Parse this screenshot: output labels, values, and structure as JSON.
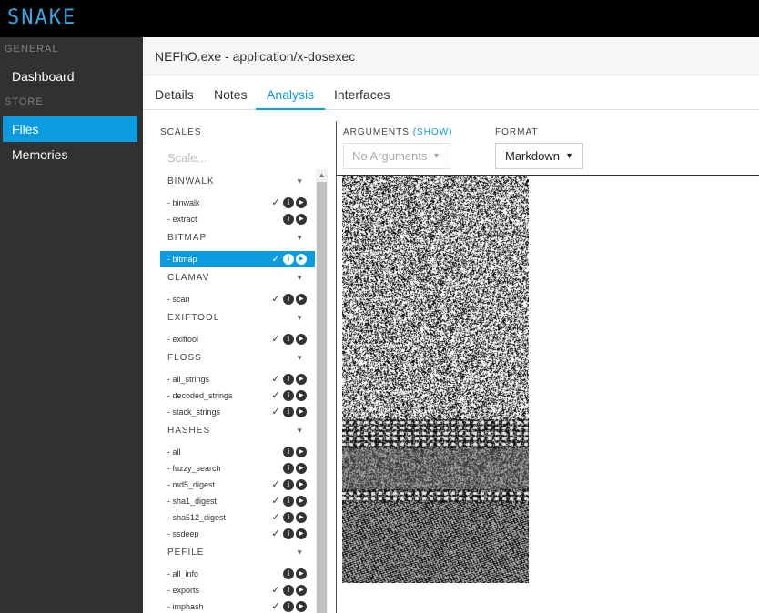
{
  "app": {
    "logo": "SNAKE"
  },
  "sidebar": {
    "general_label": "GENERAL",
    "dashboard": "Dashboard",
    "store_label": "STORE",
    "files": "Files",
    "memories": "Memories"
  },
  "header": {
    "title": "NEFhO.exe - application/x-dosexec"
  },
  "tabs": [
    {
      "label": "Details"
    },
    {
      "label": "Notes"
    },
    {
      "label": "Analysis"
    },
    {
      "label": "Interfaces"
    }
  ],
  "scales": {
    "title": "SCALES",
    "search_placeholder": "Scale...",
    "groups": [
      {
        "name": "BINWALK",
        "items": [
          {
            "label": "- binwalk",
            "done": true,
            "active": false
          },
          {
            "label": "- extract",
            "done": false,
            "active": false
          }
        ]
      },
      {
        "name": "BITMAP",
        "items": [
          {
            "label": "- bitmap",
            "done": true,
            "active": true
          }
        ]
      },
      {
        "name": "CLAMAV",
        "items": [
          {
            "label": "- scan",
            "done": true,
            "active": false
          }
        ]
      },
      {
        "name": "EXIFTOOL",
        "items": [
          {
            "label": "- exiftool",
            "done": true,
            "active": false
          }
        ]
      },
      {
        "name": "FLOSS",
        "items": [
          {
            "label": "- all_strings",
            "done": true,
            "active": false
          },
          {
            "label": "- decoded_strings",
            "done": true,
            "active": false
          },
          {
            "label": "- stack_strings",
            "done": true,
            "active": false
          }
        ]
      },
      {
        "name": "HASHES",
        "items": [
          {
            "label": "- all",
            "done": false,
            "active": false
          },
          {
            "label": "- fuzzy_search",
            "done": false,
            "active": false
          },
          {
            "label": "- md5_digest",
            "done": true,
            "active": false
          },
          {
            "label": "- sha1_digest",
            "done": true,
            "active": false
          },
          {
            "label": "- sha512_digest",
            "done": true,
            "active": false
          },
          {
            "label": "- ssdeep",
            "done": true,
            "active": false
          }
        ]
      },
      {
        "name": "PEFILE",
        "items": [
          {
            "label": "- all_info",
            "done": false,
            "active": false
          },
          {
            "label": "- exports",
            "done": true,
            "active": false
          },
          {
            "label": "- imphash",
            "done": true,
            "active": false
          }
        ]
      }
    ]
  },
  "analysis": {
    "arguments_label": "ARGUMENTS",
    "arguments_show": "(SHOW)",
    "arguments_value": "No Arguments",
    "format_label": "FORMAT",
    "format_value": "Markdown"
  },
  "colors": {
    "accent": "#0a9cde",
    "sidebar": "#313131",
    "topbar": "#000000"
  }
}
